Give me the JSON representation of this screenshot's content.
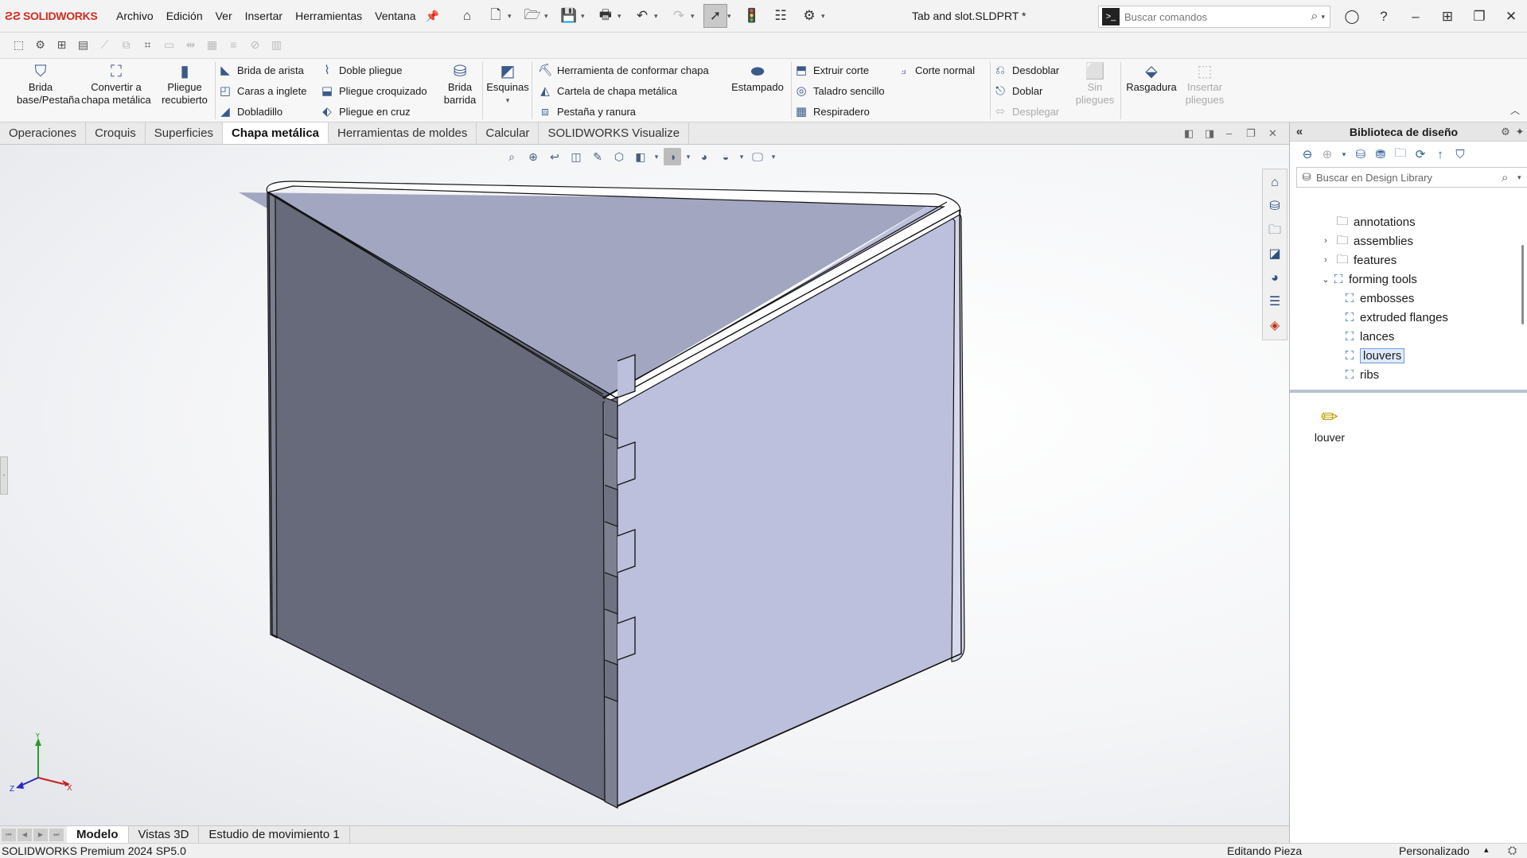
{
  "app": {
    "brand": "SOLIDWORKS",
    "doc_title": "Tab and slot.SLDPRT *",
    "menu": [
      "Archivo",
      "Edición",
      "Ver",
      "Insertar",
      "Herramientas",
      "Ventana"
    ],
    "search_placeholder": "Buscar comandos"
  },
  "ribbon": {
    "brida_base": "Brida base/Pestaña",
    "convertir": "Convertir a chapa metálica",
    "pliegue_recubierto": "Pliegue recubierto",
    "brida_arista": "Brida de arista",
    "caras_inglete": "Caras a inglete",
    "dobladillo": "Dobladillo",
    "doble_pliegue": "Doble pliegue",
    "pliegue_croquizado": "Pliegue croquizado",
    "pliegue_cruz": "Pliegue en cruz",
    "brida_barrida": "Brida barrida",
    "esquinas": "Esquinas",
    "conformar": "Herramienta de conformar chapa",
    "cartela": "Cartela de chapa metálica",
    "pestana_ranura": "Pestaña y ranura",
    "estampado": "Estampado",
    "extruir_corte": "Extruir corte",
    "taladro": "Taladro sencillo",
    "respiradero": "Respiradero",
    "corte_normal": "Corte normal",
    "desdoblar": "Desdoblar",
    "doblar": "Doblar",
    "desplegar": "Desplegar",
    "sin_pliegues": "Sin pliegues",
    "rasgadura": "Rasgadura",
    "insertar_pliegues": "Insertar pliegues"
  },
  "tabs": [
    "Operaciones",
    "Croquis",
    "Superficies",
    "Chapa metálica",
    "Herramientas de moldes",
    "Calcular",
    "SOLIDWORKS Visualize"
  ],
  "active_tab": "Chapa metálica",
  "bottom_tabs": [
    "Modelo",
    "Vistas 3D",
    "Estudio de movimiento 1"
  ],
  "status": {
    "version": "SOLIDWORKS Premium 2024 SP5.0",
    "mode": "Editando Pieza",
    "units": "Personalizado"
  },
  "design_library": {
    "title": "Biblioteca de diseño",
    "search_placeholder": "Buscar en Design Library",
    "tree": [
      {
        "label": "annotations"
      },
      {
        "label": "assemblies"
      },
      {
        "label": "features"
      },
      {
        "label": "forming tools"
      },
      {
        "label": "embosses"
      },
      {
        "label": "extruded flanges"
      },
      {
        "label": "lances"
      },
      {
        "label": "louvers"
      },
      {
        "label": "ribs"
      }
    ],
    "preview_item": "louver"
  },
  "triad": {
    "x": "X",
    "y": "Y",
    "z": "Z"
  },
  "colors": {
    "left_face": "#666a7a",
    "right_face": "#bcc0dc",
    "inner_face": "#a2a6c1",
    "rim": "#ffffff",
    "brand": "#d52b1e"
  }
}
